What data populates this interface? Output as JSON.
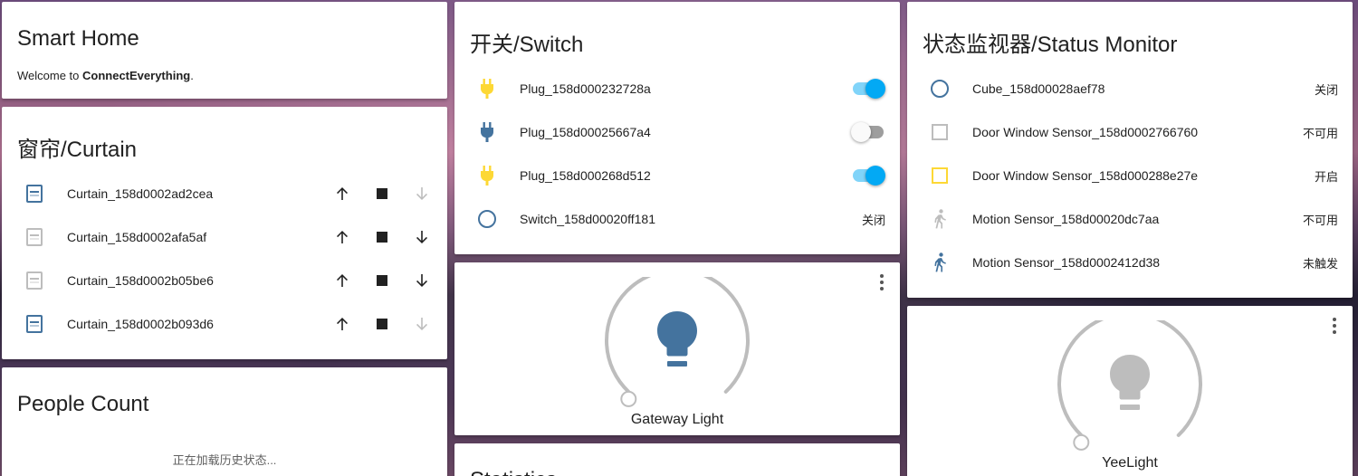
{
  "colors": {
    "accent": "#03a9f4",
    "icon_on": "#fdd835",
    "icon_default": "#44739e",
    "icon_unavailable": "#bdbdbd",
    "slider_track": "#bdbdbd"
  },
  "smart_home": {
    "title": "Smart Home",
    "welcome_prefix": "Welcome to ",
    "welcome_brand": "ConnectEverything",
    "welcome_suffix": "."
  },
  "curtain": {
    "title": "窗帘/Curtain",
    "items": [
      {
        "name": "Curtain_158d0002ad2cea",
        "icon": "window-shutter-icon",
        "icon_state": "default",
        "down_enabled": false
      },
      {
        "name": "Curtain_158d0002afa5af",
        "icon": "window-shutter-icon",
        "icon_state": "unavailable",
        "down_enabled": true
      },
      {
        "name": "Curtain_158d0002b05be6",
        "icon": "window-shutter-icon",
        "icon_state": "unavailable",
        "down_enabled": true
      },
      {
        "name": "Curtain_158d0002b093d6",
        "icon": "window-shutter-icon",
        "icon_state": "default",
        "down_enabled": false
      }
    ]
  },
  "people_count": {
    "title": "People Count",
    "loading_text": "正在加载历史状态..."
  },
  "switch": {
    "title": "开关/Switch",
    "items": [
      {
        "name": "Plug_158d000232728a",
        "icon": "power-plug-icon",
        "icon_state": "on",
        "control": "toggle",
        "on": true
      },
      {
        "name": "Plug_158d00025667a4",
        "icon": "power-plug-icon",
        "icon_state": "off",
        "control": "toggle",
        "on": false
      },
      {
        "name": "Plug_158d000268d512",
        "icon": "power-plug-icon",
        "icon_state": "on",
        "control": "toggle",
        "on": true
      },
      {
        "name": "Switch_158d00020ff181",
        "icon": "circle-outline-icon",
        "icon_state": "off",
        "control": "state",
        "state": "关闭"
      }
    ]
  },
  "gateway_light": {
    "name": "Gateway Light",
    "icon": "lightbulb-icon",
    "state": "on"
  },
  "statistics": {
    "title": "Statistics"
  },
  "status_monitor": {
    "title": "状态监视器/Status Monitor",
    "items": [
      {
        "name": "Cube_158d00028aef78",
        "icon": "circle-outline-icon",
        "icon_state": "default",
        "state": "关闭"
      },
      {
        "name": "Door Window Sensor_158d0002766760",
        "icon": "square-outline-icon",
        "icon_state": "unavailable",
        "state": "不可用"
      },
      {
        "name": "Door Window Sensor_158d000288e27e",
        "icon": "square-outline-icon",
        "icon_state": "on",
        "state": "开启"
      },
      {
        "name": "Motion Sensor_158d00020dc7aa",
        "icon": "walk-icon",
        "icon_state": "unavailable",
        "state": "不可用"
      },
      {
        "name": "Motion Sensor_158d0002412d38",
        "icon": "walk-icon",
        "icon_state": "default",
        "state": "未触发"
      }
    ]
  },
  "yeelight": {
    "name": "YeeLight",
    "icon": "lightbulb-icon",
    "state": "off"
  }
}
